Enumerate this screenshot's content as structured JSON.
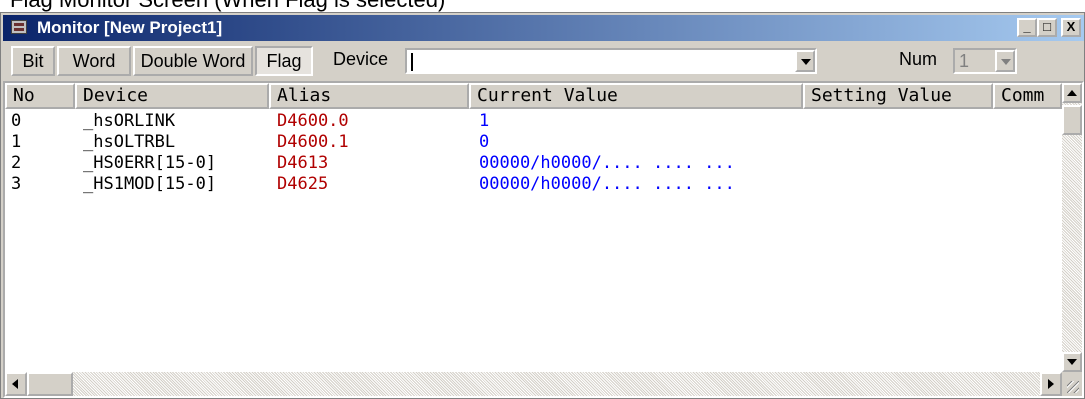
{
  "caption_above": "Flag Monitor Screen (When Flag is selected)",
  "window": {
    "title": "Monitor [New Project1]",
    "controls": {
      "minimize": "_",
      "maximize": "□",
      "close": "X"
    }
  },
  "toolbar": {
    "buttons": [
      {
        "label": "Bit"
      },
      {
        "label": "Word"
      },
      {
        "label": "Double Word"
      },
      {
        "label": "Flag",
        "selected": true
      }
    ],
    "device_label": "Device",
    "device_value": "",
    "num_label": "Num",
    "num_value": "1"
  },
  "table": {
    "columns": [
      "No",
      "Device",
      "Alias",
      "Current Value",
      "Setting Value",
      "Comm"
    ],
    "rows": [
      {
        "no": "0",
        "device": "_hsORLINK",
        "alias": "D4600.0",
        "current": "1",
        "setting": ""
      },
      {
        "no": "1",
        "device": "_hsOLTRBL",
        "alias": "D4600.1",
        "current": "0",
        "setting": ""
      },
      {
        "no": "2",
        "device": "_HS0ERR[15-0]",
        "alias": "D4613",
        "current": "00000/h0000/.... .... ...",
        "setting": ""
      },
      {
        "no": "3",
        "device": "_HS1MOD[15-0]",
        "alias": "D4625",
        "current": "00000/h0000/.... .... ...",
        "setting": ""
      }
    ]
  },
  "colors": {
    "alias": "#b00000",
    "current_value": "#0000ff",
    "titlebar": "#0a246a"
  }
}
